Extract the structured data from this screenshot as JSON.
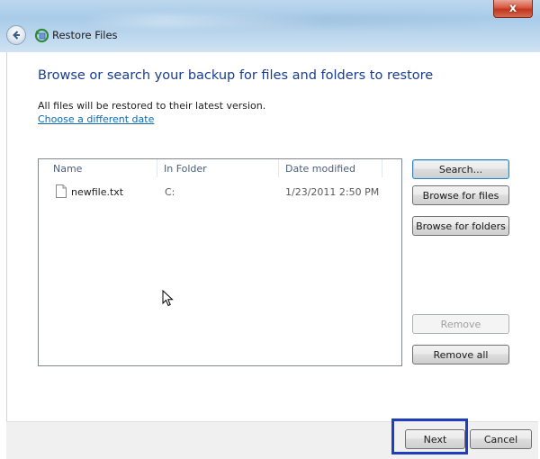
{
  "window": {
    "title": "Restore Files",
    "close_label": "x"
  },
  "page": {
    "heading": "Browse or search your backup for files and folders to restore",
    "info": "All files will be restored to their latest version.",
    "date_link": "Choose a different date"
  },
  "list": {
    "columns": [
      "Name",
      "In Folder",
      "Date modified"
    ],
    "rows": [
      {
        "name": "newfile.txt",
        "folder": "C:",
        "date": "1/23/2011 2:50 PM"
      }
    ]
  },
  "side_buttons": {
    "search": "Search...",
    "browse_files": "Browse for files",
    "browse_folders": "Browse for folders",
    "remove": "Remove",
    "remove_all": "Remove all"
  },
  "footer": {
    "next": "Next",
    "cancel": "Cancel"
  },
  "colors": {
    "heading": "#1a3d8f",
    "link": "#0a6ab8",
    "highlight": "#1f3ebd"
  },
  "icons": [
    "close-icon",
    "back-arrow-icon",
    "restore-files-icon",
    "text-file-icon",
    "mouse-cursor-icon"
  ]
}
